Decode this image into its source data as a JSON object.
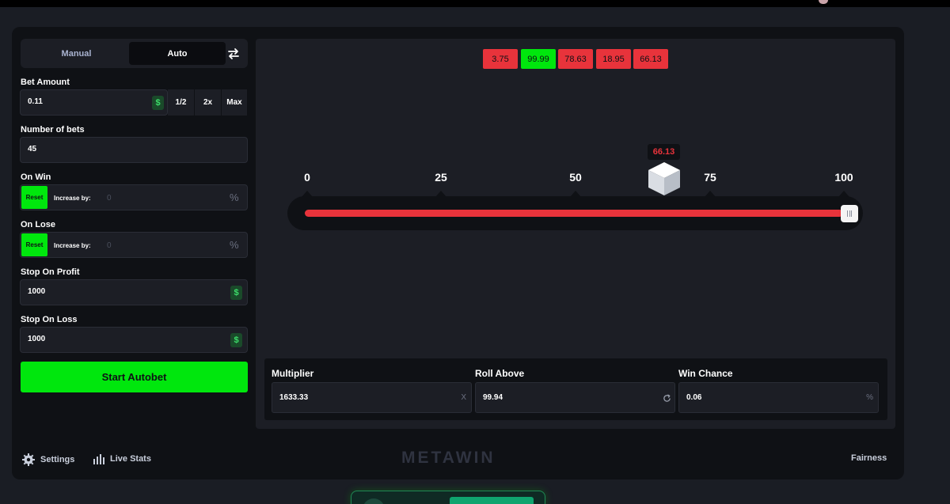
{
  "tabs": {
    "manual": "Manual",
    "auto": "Auto"
  },
  "bet_amount": {
    "label": "Bet Amount",
    "value": "0.11",
    "currency_icon": "$",
    "half": "1/2",
    "double": "2x",
    "max": "Max"
  },
  "number_of_bets": {
    "label": "Number of bets",
    "value": "45"
  },
  "on_win": {
    "label": "On Win",
    "reset": "Reset",
    "increase_by": "Increase by:",
    "value": "0",
    "suffix": "%"
  },
  "on_lose": {
    "label": "On Lose",
    "reset": "Reset",
    "increase_by": "Increase by:",
    "value": "0",
    "suffix": "%"
  },
  "stop_on_profit": {
    "label": "Stop On Profit",
    "value": "1000",
    "currency_icon": "$"
  },
  "stop_on_loss": {
    "label": "Stop On Loss",
    "value": "1000",
    "currency_icon": "$"
  },
  "start_button": "Start Autobet",
  "history": [
    {
      "value": "3.75",
      "status": "loss"
    },
    {
      "value": "99.99",
      "status": "win"
    },
    {
      "value": "78.63",
      "status": "loss"
    },
    {
      "value": "18.95",
      "status": "loss"
    },
    {
      "value": "66.13",
      "status": "loss"
    }
  ],
  "slider": {
    "ticks": [
      "0",
      "25",
      "50",
      "75",
      "100"
    ],
    "result": "66.13",
    "roll_above": 99.94,
    "max": 100
  },
  "stats": {
    "multiplier": {
      "label": "Multiplier",
      "value": "1633.33",
      "suffix": "X"
    },
    "roll_above": {
      "label": "Roll Above",
      "value": "99.94"
    },
    "win_chance": {
      "label": "Win Chance",
      "value": "0.06",
      "suffix": "%"
    }
  },
  "footer": {
    "settings": "Settings",
    "live_stats": "Live Stats",
    "logo": "METAWIN",
    "fairness": "Fairness"
  },
  "colors": {
    "win": "#00e70d",
    "loss": "#e8333b",
    "bg": "#0f1115",
    "panel": "#1c1e25"
  }
}
